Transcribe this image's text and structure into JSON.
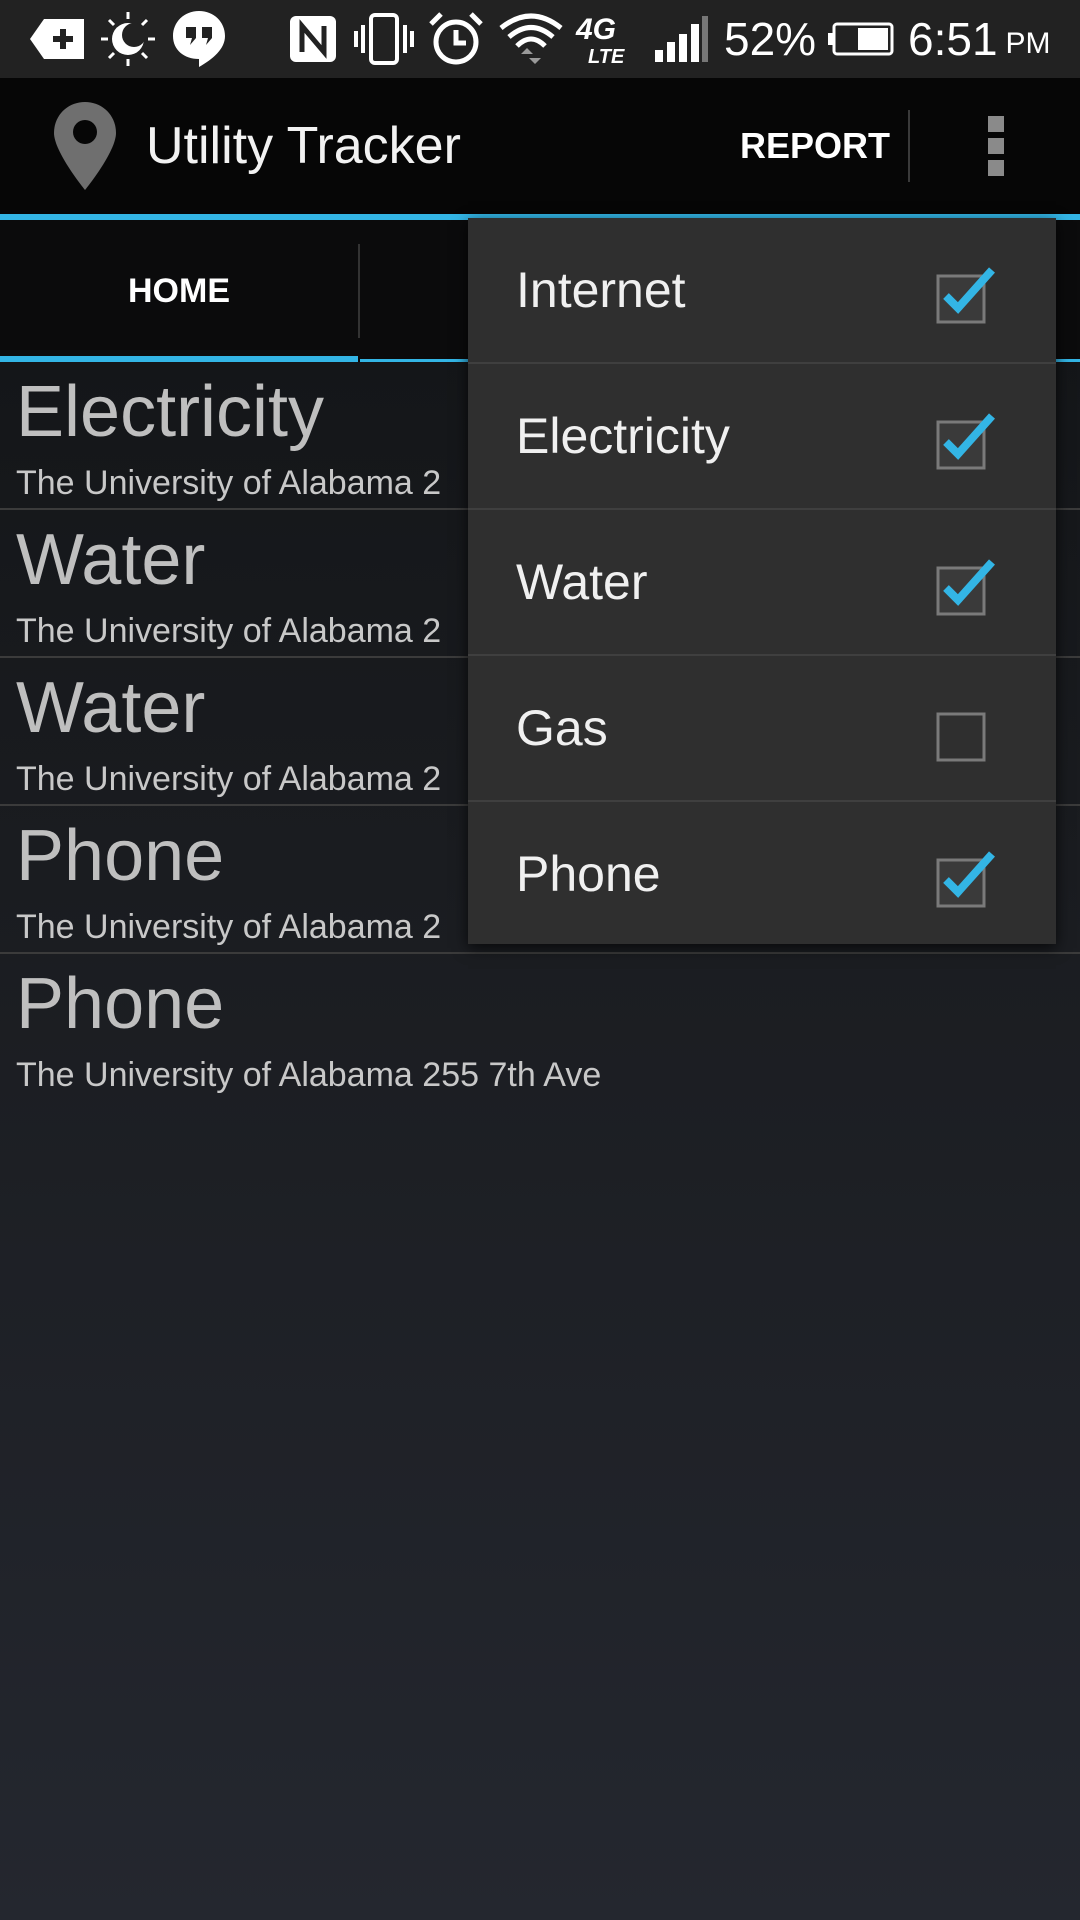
{
  "status_bar": {
    "battery": "52%",
    "time": "6:51",
    "ampm": "PM",
    "network": "4G LTE"
  },
  "action_bar": {
    "title": "Utility Tracker",
    "report_label": "REPORT",
    "accent_color": "#33b5e5"
  },
  "tabs": [
    {
      "label": "HOME",
      "selected": true
    }
  ],
  "list": [
    {
      "title": "Electricity",
      "subtitle": "The University of Alabama 2"
    },
    {
      "title": "Water",
      "subtitle": "The University of Alabama 2"
    },
    {
      "title": "Water",
      "subtitle": "The University of Alabama 2"
    },
    {
      "title": "Phone",
      "subtitle": "The University of Alabama 2"
    },
    {
      "title": "Phone",
      "subtitle": "The University of Alabama 255 7th Ave"
    }
  ],
  "filter_menu": [
    {
      "label": "Internet",
      "checked": true
    },
    {
      "label": "Electricity",
      "checked": true
    },
    {
      "label": "Water",
      "checked": true
    },
    {
      "label": "Gas",
      "checked": false
    },
    {
      "label": "Phone",
      "checked": true
    }
  ]
}
